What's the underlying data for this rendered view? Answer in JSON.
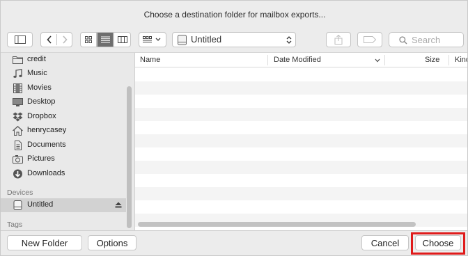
{
  "dialog": {
    "title": "Choose a destination folder for mailbox exports..."
  },
  "toolbar": {
    "location": "Untitled",
    "search_placeholder": "Search"
  },
  "sidebar": {
    "favorites": [
      {
        "label": "credit",
        "icon": "folder-icon"
      },
      {
        "label": "Music",
        "icon": "music-icon"
      },
      {
        "label": "Movies",
        "icon": "movies-icon"
      },
      {
        "label": "Desktop",
        "icon": "desktop-icon"
      },
      {
        "label": "Dropbox",
        "icon": "dropbox-icon"
      },
      {
        "label": "henrycasey",
        "icon": "home-icon"
      },
      {
        "label": "Documents",
        "icon": "documents-icon"
      },
      {
        "label": "Pictures",
        "icon": "pictures-icon"
      },
      {
        "label": "Downloads",
        "icon": "downloads-icon"
      }
    ],
    "devices_heading": "Devices",
    "devices": [
      {
        "label": "Untitled",
        "icon": "drive-icon",
        "selected": true
      }
    ],
    "tags_heading": "Tags"
  },
  "filelist": {
    "columns": [
      "Name",
      "Date Modified",
      "Size",
      "Kind"
    ]
  },
  "buttons": {
    "new_folder": "New Folder",
    "options": "Options",
    "cancel": "Cancel",
    "choose": "Choose"
  },
  "colors": {
    "highlight": "#e01b1b",
    "selected_segment": "#6e6e6e"
  }
}
